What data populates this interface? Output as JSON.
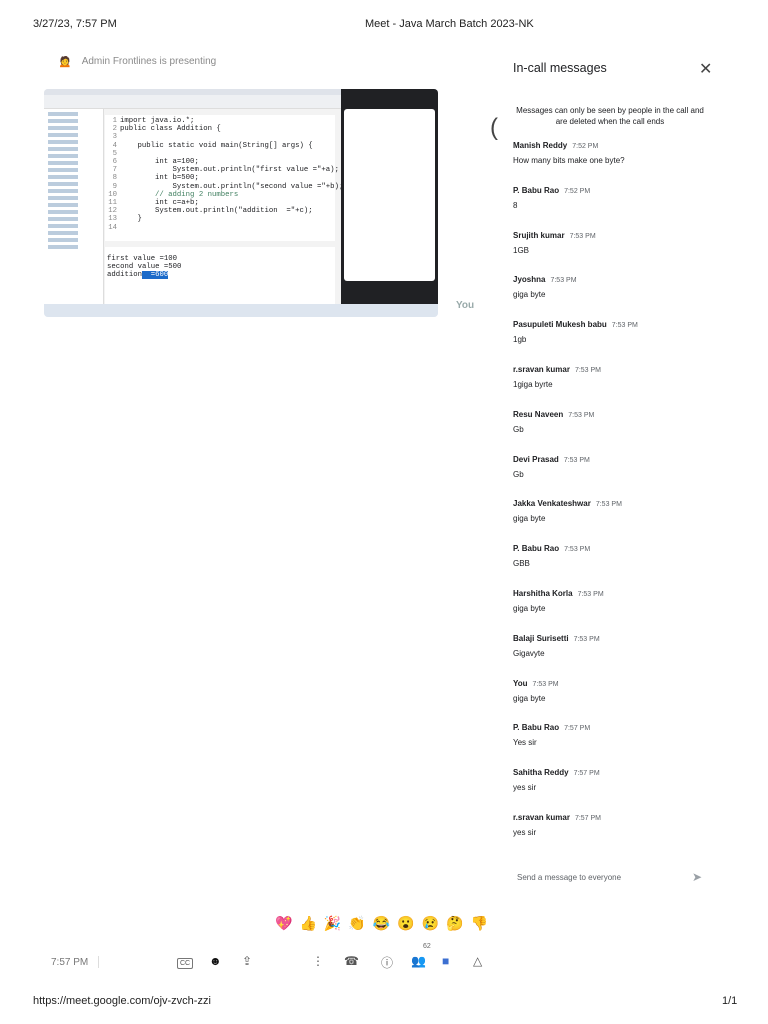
{
  "print_header": {
    "datetime": "3/27/23, 7:57 PM",
    "title": "Meet - Java March Batch 2023-NK"
  },
  "print_footer": {
    "url": "https://meet.google.com/ojv-zvch-zzi",
    "page": "1/1"
  },
  "presenting": "Admin Frontlines is presenting",
  "shared_screen": {
    "code": [
      {
        "n": "1",
        "t": "import java.io.*;"
      },
      {
        "n": "2",
        "t": "public class Addition {"
      },
      {
        "n": "3",
        "t": ""
      },
      {
        "n": "4",
        "t": "    public static void main(String[] args) {"
      },
      {
        "n": "5",
        "t": ""
      },
      {
        "n": "6",
        "t": "        int a=100;"
      },
      {
        "n": "7",
        "t": "            System.out.println(\"first value =\"+a);"
      },
      {
        "n": "8",
        "t": "        int b=500;"
      },
      {
        "n": "9",
        "t": "            System.out.println(\"second value =\"+b);"
      },
      {
        "n": "10",
        "t": "        // adding 2 numbers"
      },
      {
        "n": "11",
        "t": "        int c=a+b;"
      },
      {
        "n": "12",
        "t": "        System.out.println(\"addition  =\"+c);"
      },
      {
        "n": "13",
        "t": "    }"
      },
      {
        "n": "14",
        "t": ""
      }
    ],
    "console": [
      "first value =100",
      "second value =500",
      "addition"
    ],
    "console_highlight": "  =600"
  },
  "self_tile_label": "You",
  "panel": {
    "title": "In-call messages",
    "notice": "Messages can only be seen by people in the call and are deleted when the call ends",
    "messages": [
      {
        "sender": "Manish Reddy",
        "time": "7:52 PM",
        "text": "How many bits make one byte?"
      },
      {
        "sender": "P. Babu Rao",
        "time": "7:52 PM",
        "text": "8"
      },
      {
        "sender": "Srujith kumar",
        "time": "7:53 PM",
        "text": "1GB"
      },
      {
        "sender": "Jyoshna",
        "time": "7:53 PM",
        "text": "giga byte"
      },
      {
        "sender": "Pasupuleti Mukesh babu",
        "time": "7:53 PM",
        "text": "1gb"
      },
      {
        "sender": "r.sravan kumar",
        "time": "7:53 PM",
        "text": "1giga byrte"
      },
      {
        "sender": "Resu Naveen",
        "time": "7:53 PM",
        "text": "Gb"
      },
      {
        "sender": "Devi Prasad",
        "time": "7:53 PM",
        "text": "Gb"
      },
      {
        "sender": "Jakka Venkateshwar",
        "time": "7:53 PM",
        "text": "giga byte"
      },
      {
        "sender": "P. Babu Rao",
        "time": "7:53 PM",
        "text": "GBB"
      },
      {
        "sender": "Harshitha Korla",
        "time": "7:53 PM",
        "text": "giga byte"
      },
      {
        "sender": "Balaji Surisetti",
        "time": "7:53 PM",
        "text": "Gigavyte"
      },
      {
        "sender": "You",
        "time": "7:53 PM",
        "text": "giga byte"
      },
      {
        "sender": "P. Babu Rao",
        "time": "7:57 PM",
        "text": "Yes sir"
      },
      {
        "sender": "Sahitha Reddy",
        "time": "7:57 PM",
        "text": "yes sir"
      },
      {
        "sender": "r.sravan kumar",
        "time": "7:57 PM",
        "text": "yes sir"
      }
    ],
    "input_placeholder": "Send a message to everyone"
  },
  "reactions": [
    "💖",
    "👍",
    "🎉",
    "👏",
    "😂",
    "😮",
    "😢",
    "🤔",
    "👎"
  ],
  "controls": {
    "clock": "7:57 PM",
    "participant_count": "62",
    "captions": "CC"
  }
}
